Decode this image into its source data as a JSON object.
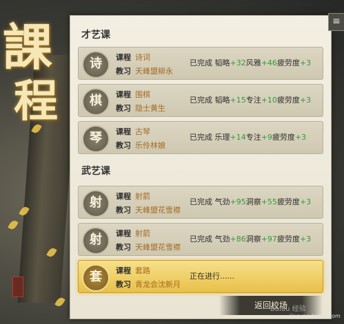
{
  "title": "課程",
  "title_chars": [
    "課",
    "程"
  ],
  "corner_icon": "hamburger-icon",
  "sections": [
    {
      "title": "才艺课",
      "rows": [
        {
          "badge": "诗",
          "course_key": "课程",
          "course": "诗词",
          "teacher_key": "教习",
          "teacher": "天峰盟柳永",
          "status_prefix": "已完成",
          "stats": [
            {
              "k": "韬略",
              "v": "+32"
            },
            {
              "k": "风雅",
              "v": "+46"
            },
            {
              "k": "疲劳度",
              "v": "+3"
            }
          ]
        },
        {
          "badge": "棋",
          "course_key": "课程",
          "course": "围棋",
          "teacher_key": "教习",
          "teacher": "隐士黄生",
          "status_prefix": "已完成",
          "stats": [
            {
              "k": "韬略",
              "v": "+15"
            },
            {
              "k": "专注",
              "v": "+10"
            },
            {
              "k": "疲劳度",
              "v": "+3"
            }
          ]
        },
        {
          "badge": "琴",
          "course_key": "课程",
          "course": "古琴",
          "teacher_key": "教习",
          "teacher": "乐伶林娘",
          "status_prefix": "已完成",
          "stats": [
            {
              "k": "乐理",
              "v": "+14"
            },
            {
              "k": "专注",
              "v": "+9"
            },
            {
              "k": "疲劳度",
              "v": "+3"
            }
          ]
        }
      ]
    },
    {
      "title": "武艺课",
      "rows": [
        {
          "badge": "射",
          "course_key": "课程",
          "course": "射箭",
          "teacher_key": "教习",
          "teacher": "天峰盟花雪襟",
          "status_prefix": "已完成",
          "stats": [
            {
              "k": "气劲",
              "v": "+95"
            },
            {
              "k": "洞察",
              "v": "+55"
            },
            {
              "k": "疲劳度",
              "v": "+3"
            }
          ]
        },
        {
          "badge": "射",
          "course_key": "课程",
          "course": "射箭",
          "teacher_key": "教习",
          "teacher": "天峰盟花雪襟",
          "status_prefix": "已完成",
          "stats": [
            {
              "k": "气劲",
              "v": "+86"
            },
            {
              "k": "洞察",
              "v": "+97"
            },
            {
              "k": "疲劳度",
              "v": "+3"
            }
          ]
        },
        {
          "badge": "套",
          "course_key": "课程",
          "course": "套路",
          "teacher_key": "教习",
          "teacher": "青龙会沈新月",
          "status_prefix": "正在进行......",
          "stats": [],
          "active": true
        }
      ]
    }
  ],
  "return_button": "返回校场",
  "watermark": "Baidu 经验",
  "watermark_url": "jingyan.baidu.com",
  "colors": {
    "accent": "#e8c04a",
    "positive": "#2f9a3a",
    "value": "#a46a1f"
  }
}
